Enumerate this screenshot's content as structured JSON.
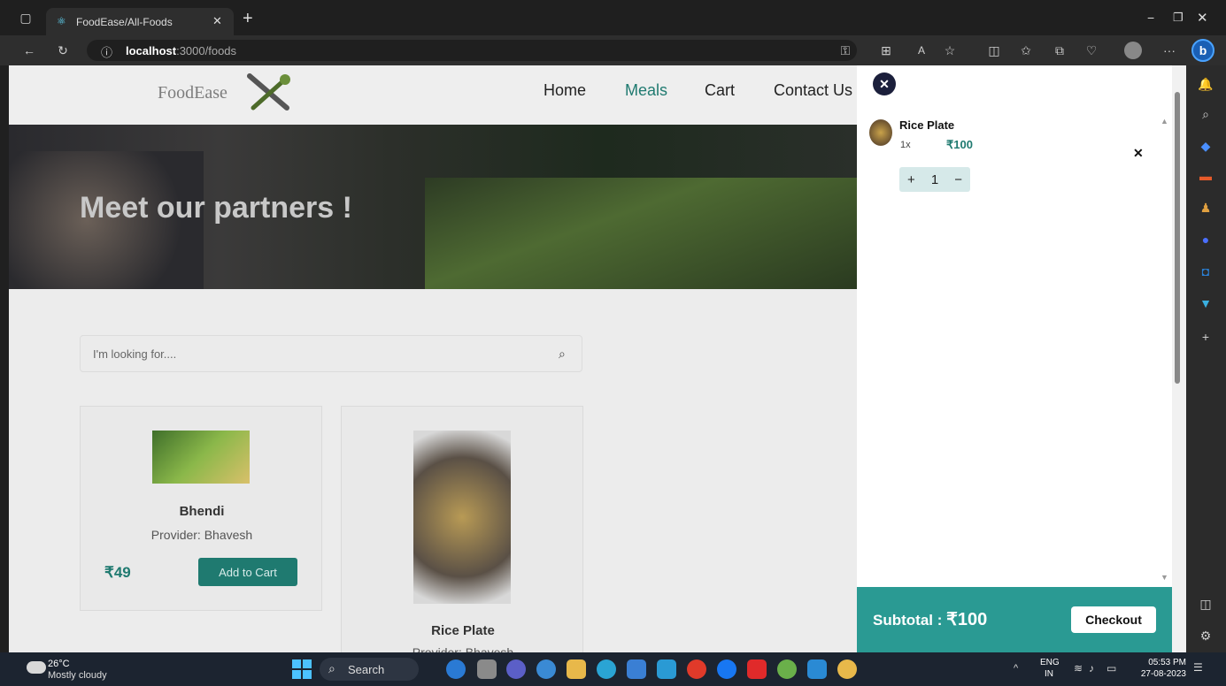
{
  "browser": {
    "tab_title": "FoodEase/All-Foods",
    "new_tab": "+",
    "url_host": "localhost",
    "url_rest": ":3000/foods",
    "minimize": "−",
    "restore": "❐",
    "close": "✕"
  },
  "site": {
    "logo": "FoodEase",
    "nav": [
      "Home",
      "Meals",
      "Cart",
      "Contact Us"
    ],
    "hero_title": "Meet our partners !",
    "search_placeholder": "I'm looking for....",
    "products": [
      {
        "name": "Bhendi",
        "provider": "Provider: Bhavesh",
        "price": "₹49",
        "button": "Add to Cart"
      },
      {
        "name": "Rice Plate",
        "provider": "Provider: Bhavesh"
      }
    ]
  },
  "cart": {
    "item_name": "Rice Plate",
    "item_qty": "1x",
    "item_price": "₹100",
    "remove": "✕",
    "plus": "+",
    "qty": "1",
    "minus": "−",
    "subtotal_label": "Subtotal : ",
    "subtotal_value": "₹100",
    "checkout": "Checkout"
  },
  "taskbar": {
    "temp": "26°C",
    "weather": "Mostly cloudy",
    "search": "Search",
    "lang1": "ENG",
    "lang2": "IN",
    "time": "05:53 PM",
    "date": "27-08-2023"
  },
  "colors": {
    "accent": "#2a9a93",
    "meals_active": "#1f7a70",
    "price": "#1f7a70"
  }
}
